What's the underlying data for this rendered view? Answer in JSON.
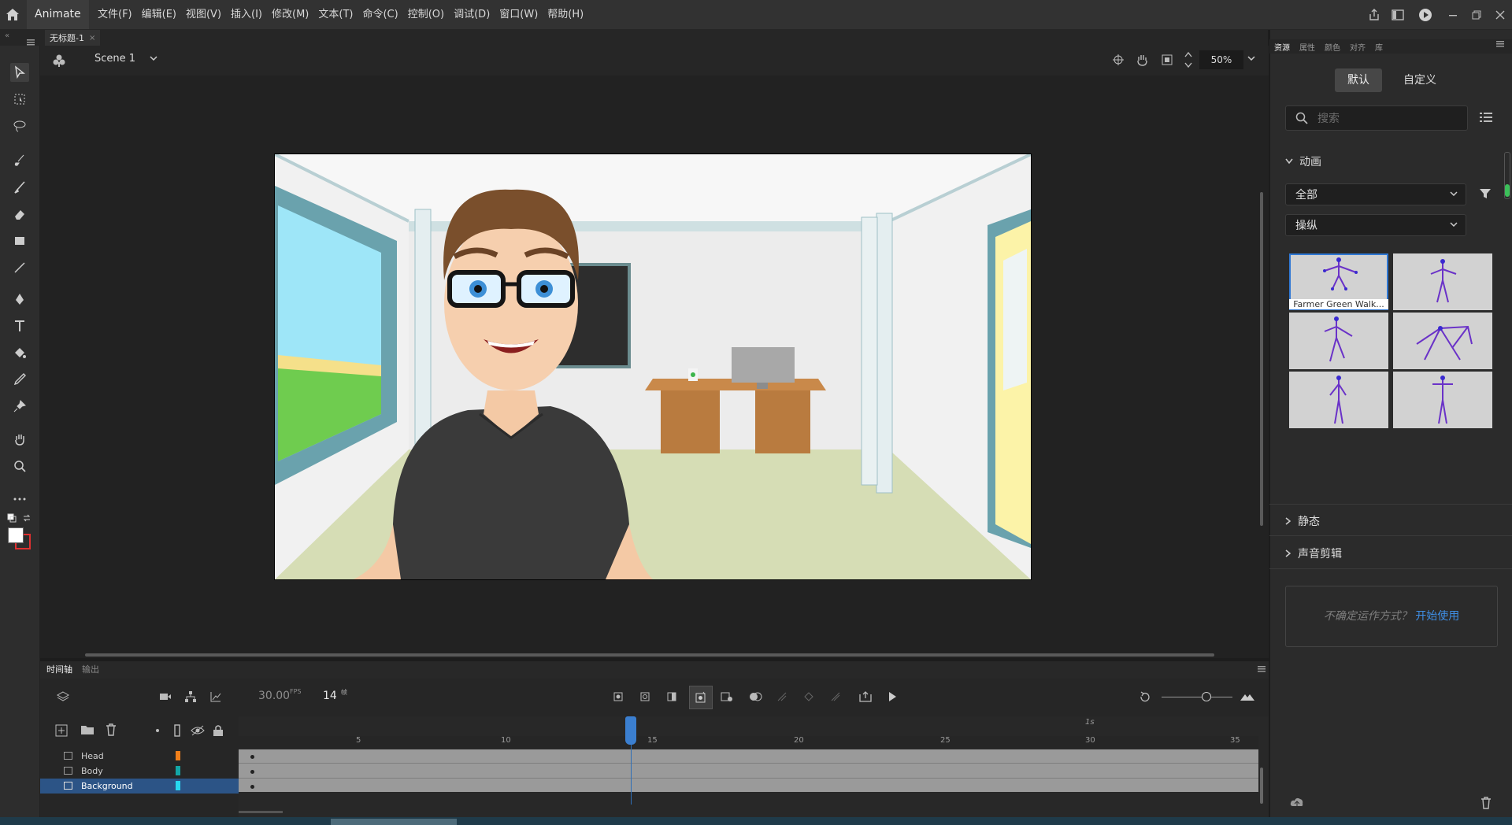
{
  "app": {
    "name": "Animate",
    "menus": [
      "文件(F)",
      "编辑(E)",
      "视图(V)",
      "插入(I)",
      "修改(M)",
      "文本(T)",
      "命令(C)",
      "控制(O)",
      "调试(D)",
      "窗口(W)",
      "帮助(H)"
    ]
  },
  "document": {
    "tab_title": "无标题-1",
    "close": "×"
  },
  "scene": {
    "name": "Scene 1",
    "zoom": "50%"
  },
  "right_panel": {
    "tabs": [
      "资源",
      "属性",
      "颜色",
      "对齐",
      "库"
    ],
    "active_tab": "资源",
    "mode_buttons": {
      "default": "默认",
      "custom": "自定义"
    },
    "search_placeholder": "搜索",
    "section_animation": "动画",
    "filter_all": "全部",
    "filter_category": "操纵",
    "thumbnail_label": "Farmer Green Walk...",
    "section_static": "静态",
    "section_sound": "声音剪辑",
    "help_text": "不确定运作方式？",
    "help_link": "开始使用"
  },
  "timeline": {
    "tabs": [
      "时间轴",
      "输出"
    ],
    "fps": "30.00",
    "fps_unit": "FPS",
    "current_frame": "14",
    "frame_unit": "帧",
    "ruler_ticks": [
      "5",
      "10",
      "15",
      "20",
      "25",
      "30",
      "35"
    ],
    "ruler_second_mark": "1s",
    "layers": [
      {
        "name": "Head",
        "color": "#f07f1a"
      },
      {
        "name": "Body",
        "color": "#13a6a6"
      },
      {
        "name": "Background",
        "color": "#27d8f0"
      }
    ]
  },
  "colors": {
    "accent": "#3b7fd0",
    "selected_layer": "#2c5486",
    "stroke_color": "#ffffff",
    "fill_color": "#e03030"
  }
}
